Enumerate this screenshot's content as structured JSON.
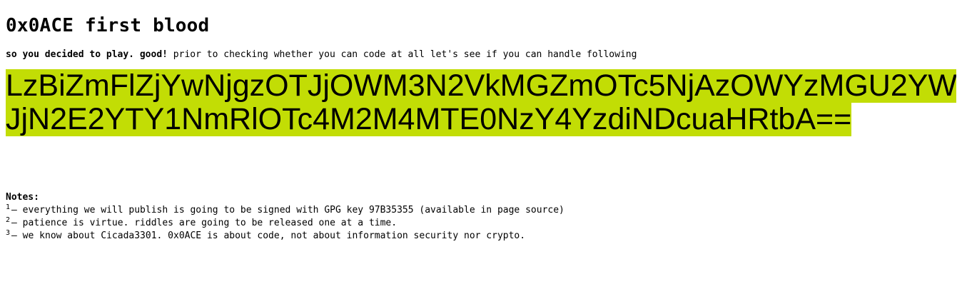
{
  "title": "0x0ACE first blood",
  "intro": {
    "bold": "so you decided to play. good!",
    "rest": " prior to checking whether you can code at all let's see if you can handle following"
  },
  "cipher": {
    "line1": "LzBiZmFlZjYwNjgzOTJjOWM3N2VkMGZmOTc5NjAzOWYzMGU2YW",
    "line2": "JjN2E2YTY1NmRlOTc4M2M4MTE0NzY4YzdiNDcuaHRtbA==",
    "highlight_color": "#c2dd05"
  },
  "notes": {
    "title": "Notes:",
    "items": [
      {
        "num": "1",
        "text": "— everything we will publish is going to be signed with GPG key 97B35355 (available in page source)"
      },
      {
        "num": "2",
        "text": "— patience is virtue. riddles are going to be released one at a time."
      },
      {
        "num": "3",
        "text": "— we know about Cicada3301. 0x0ACE is about code, not about information security nor crypto."
      }
    ]
  }
}
